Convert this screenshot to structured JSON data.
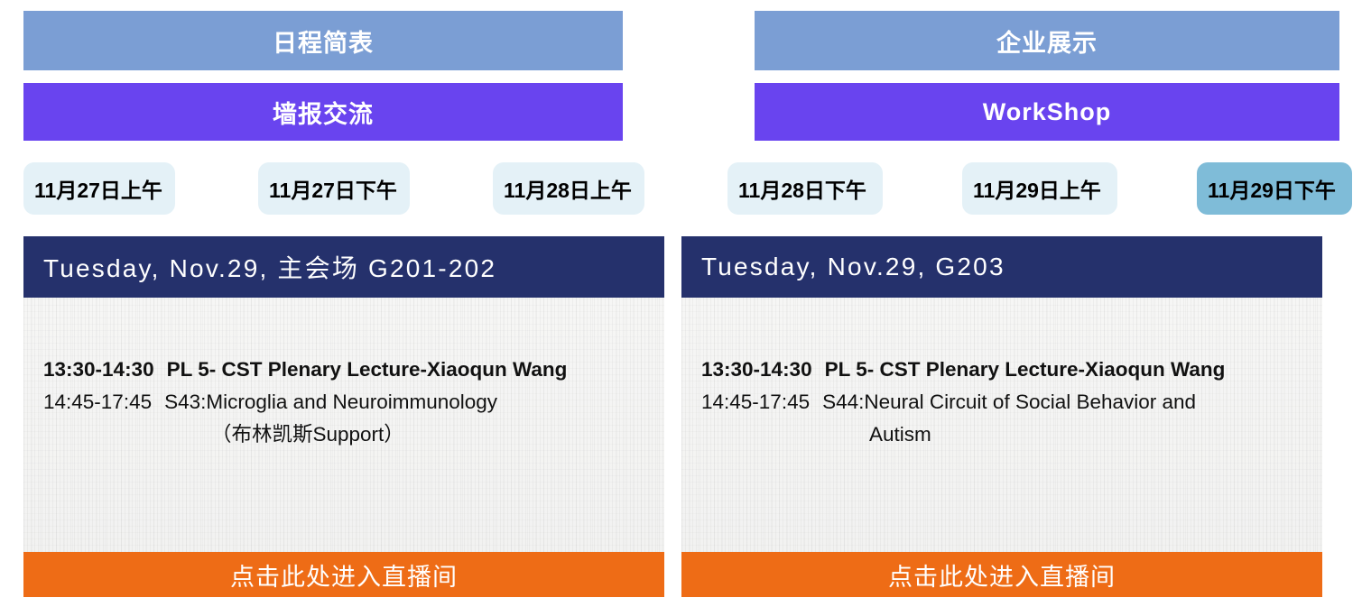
{
  "banners": {
    "primary": [
      {
        "label": "日程简表",
        "tone": "slate"
      },
      {
        "label": "企业展示",
        "tone": "slate"
      }
    ],
    "secondary": [
      {
        "label": "墙报交流",
        "tone": "violet"
      },
      {
        "label": "WorkShop",
        "tone": "violet"
      }
    ]
  },
  "tabs": [
    {
      "label": "11月27日上午",
      "active": false
    },
    {
      "label": "11月27日下午",
      "active": false
    },
    {
      "label": "11月28日上午",
      "active": false
    },
    {
      "label": "11月28日下午",
      "active": false
    },
    {
      "label": "11月29日上午",
      "active": false
    },
    {
      "label": "11月29日下午",
      "active": true
    }
  ],
  "cards": [
    {
      "header": "Tuesday, Nov.29, 主会场 G201-202",
      "rows": [
        {
          "time": "13:30-14:30",
          "desc": "PL 5- CST Plenary Lecture-Xiaoqun Wang",
          "bold": true
        },
        {
          "time": "14:45-17:45",
          "desc": "S43:Microglia and Neuroimmunology",
          "bold": false
        },
        {
          "time": "",
          "desc": "（布林凯斯Support）",
          "bold": false,
          "continuation": true
        }
      ],
      "cta": "点击此处进入直播间"
    },
    {
      "header": "Tuesday, Nov.29, G203",
      "rows": [
        {
          "time": "13:30-14:30",
          "desc": "PL 5- CST Plenary Lecture-Xiaoqun Wang",
          "bold": true
        },
        {
          "time": "14:45-17:45",
          "desc": "S44:Neural Circuit of Social Behavior and",
          "bold": false
        },
        {
          "time": "",
          "desc": "Autism",
          "bold": false,
          "continuation": true
        }
      ],
      "cta": "点击此处进入直播间"
    }
  ],
  "colors": {
    "banner_slate": "#7b9ed4",
    "banner_violet": "#6944ef",
    "tab_idle": "#e4f1f7",
    "tab_active": "#7fbcd8",
    "card_header_navy": "#25316c",
    "cta_orange": "#ee6c16"
  }
}
